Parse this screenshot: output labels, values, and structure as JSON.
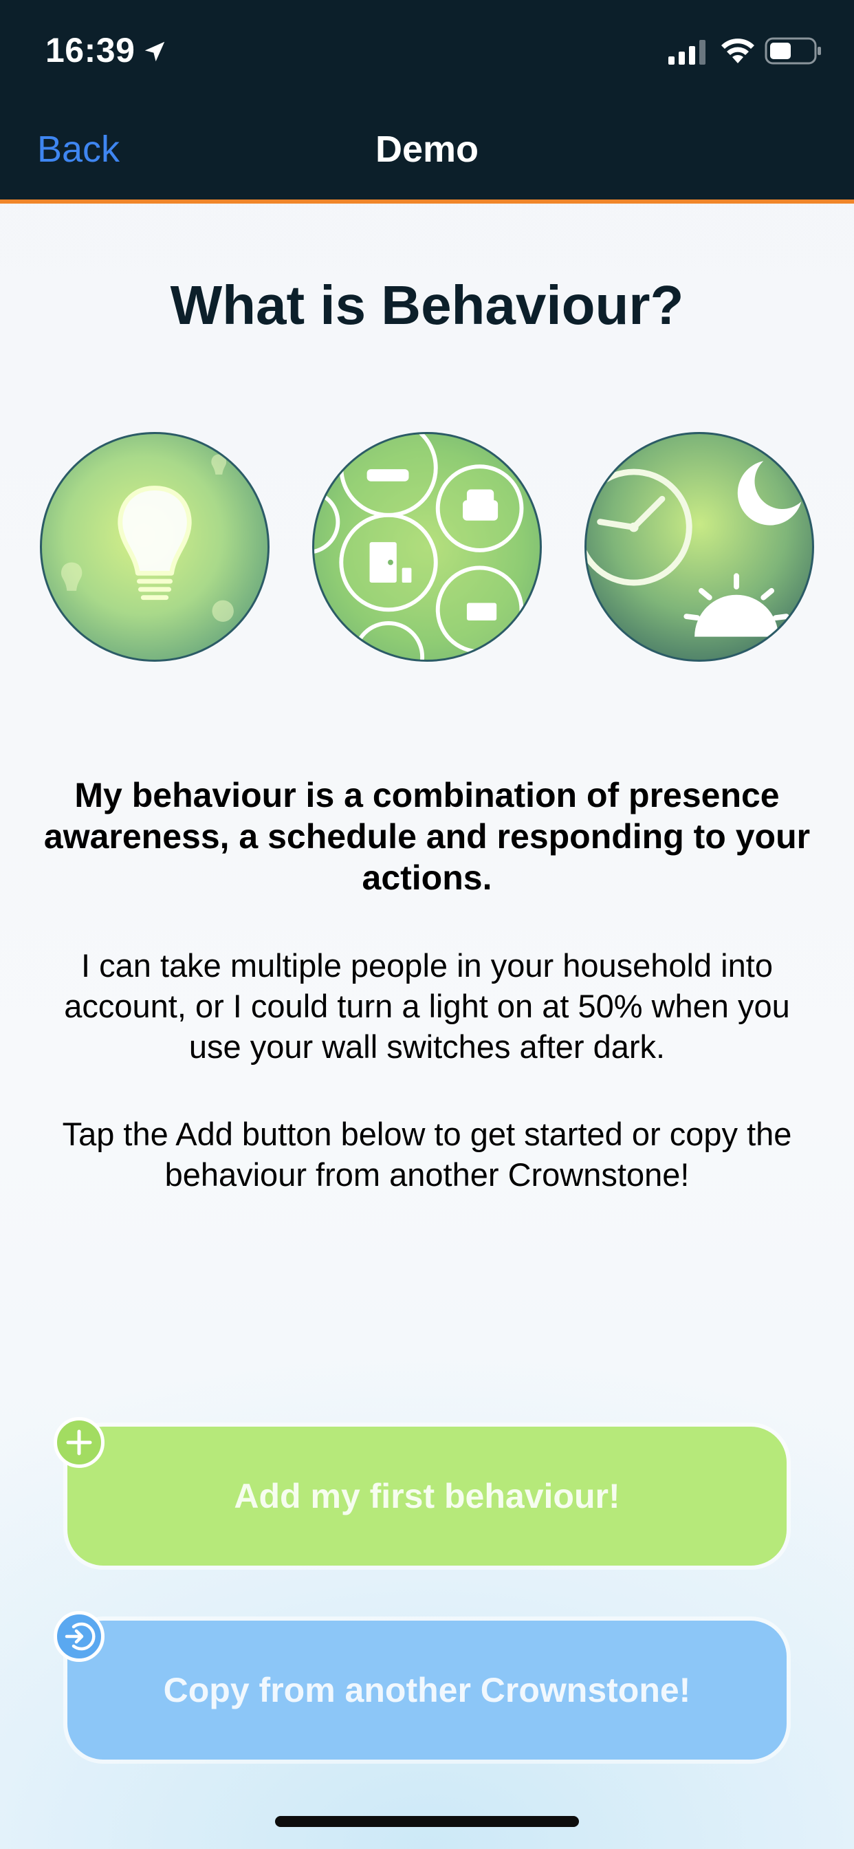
{
  "status_bar": {
    "time": "16:39",
    "icons": [
      "location-arrow-icon",
      "cellular-signal-icon",
      "wifi-icon",
      "battery-icon"
    ]
  },
  "nav": {
    "back_label": "Back",
    "title": "Demo"
  },
  "main": {
    "heading": "What is Behaviour?",
    "illustrations": [
      "lightbulb-icon",
      "household-items-icon",
      "clock-moon-sunrise-icon"
    ],
    "bold_paragraph": "My behaviour is a combination of presence awareness, a schedule and responding to your actions.",
    "paragraph_2": "I can take multiple people in your household into account, or I could turn a light on at 50% when you use your wall switches after dark.",
    "paragraph_3": "Tap the Add button below to get started or copy the behaviour from another Crownstone!"
  },
  "buttons": {
    "add_label": "Add my first behaviour!",
    "copy_label": "Copy from another Crownstone!"
  },
  "colors": {
    "header_bg": "#0c1f2a",
    "accent_orange": "#f0862a",
    "back_link": "#3f86f1",
    "add_button": "#b6e97a",
    "copy_button": "#8cc6f7"
  }
}
